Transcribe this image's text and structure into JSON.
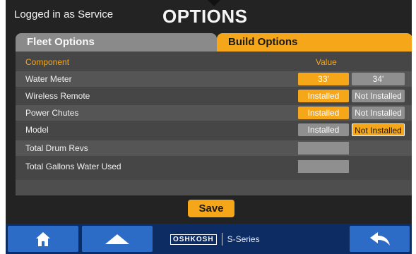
{
  "header": {
    "login_text": "Logged in as Service",
    "title": "OPTIONS"
  },
  "tabs": [
    {
      "label": "Fleet Options",
      "active": false
    },
    {
      "label": "Build Options",
      "active": true
    }
  ],
  "table": {
    "headers": {
      "component": "Component",
      "value": "Value"
    },
    "rows": [
      {
        "label": "Water Meter",
        "opt1": "33'",
        "opt2": "34'",
        "selected": "33'"
      },
      {
        "label": "Wireless Remote",
        "opt1": "Installed",
        "opt2": "Not Installed",
        "selected": "Installed"
      },
      {
        "label": "Power Chutes",
        "opt1": "Installed",
        "opt2": "Not Installed",
        "selected": "Installed"
      },
      {
        "label": "Model",
        "opt1": "Installed",
        "opt2": "Not Installed",
        "selected": "Not Installed"
      },
      {
        "label": "Total Drum Revs",
        "value": ""
      },
      {
        "label": "Total Gallons Water Used",
        "value": ""
      }
    ]
  },
  "save_label": "Save",
  "footer": {
    "brand_logo": "OSHKOSH",
    "brand_series": "S-Series",
    "icons": [
      "home-icon",
      "up-arrow-icon",
      "back-arrow-icon"
    ]
  },
  "colors": {
    "accent": "#f5a619",
    "background": "#232323",
    "nav_bar": "#0c2c63",
    "nav_button": "#2d6cc6",
    "inactive_button": "#8f8f8f"
  }
}
